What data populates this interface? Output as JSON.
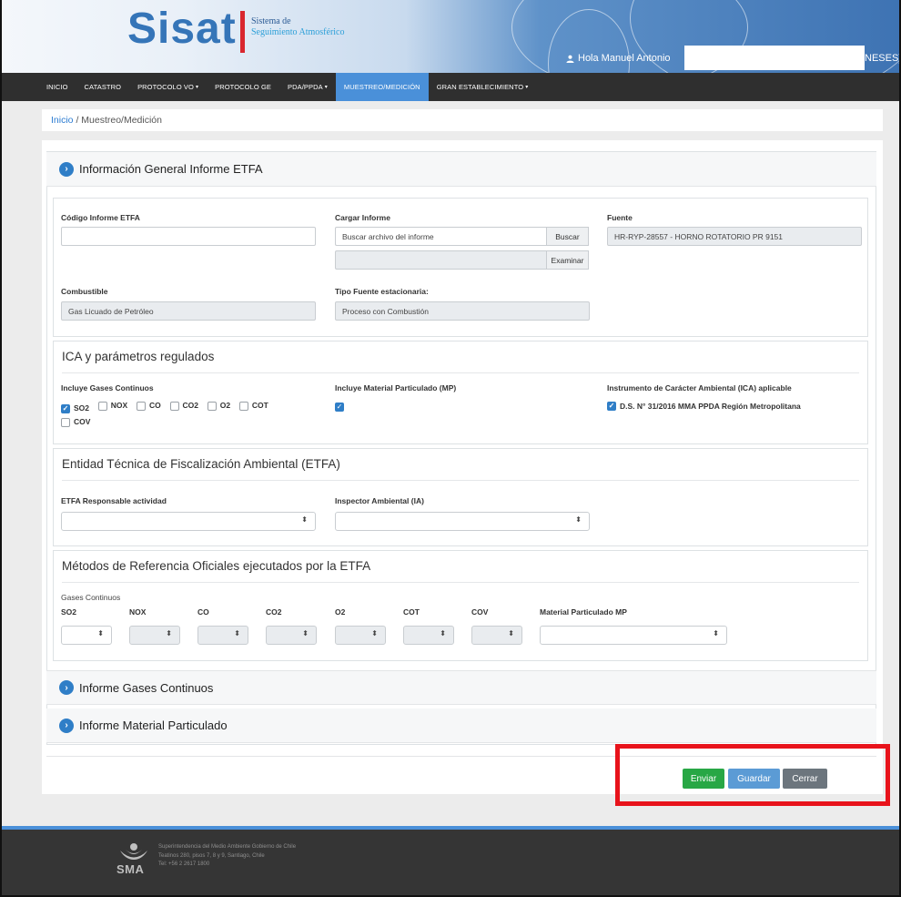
{
  "header": {
    "logo": "Sisat",
    "logo_sub1": "Sistema de",
    "logo_sub2": "Seguimiento Atmosférico",
    "user_greeting": "Hola Manuel Antonio",
    "user_tail": "NESES)",
    "user_icon": "user-icon"
  },
  "nav": {
    "items": [
      {
        "label": "INICIO",
        "dropdown": false
      },
      {
        "label": "CATASTRO",
        "dropdown": false
      },
      {
        "label": "PROTOCOLO VO",
        "dropdown": true
      },
      {
        "label": "PROTOCOLO GE",
        "dropdown": false
      },
      {
        "label": "PDA/PPDA",
        "dropdown": true
      },
      {
        "label": "MUESTREO/MEDICIÓN",
        "dropdown": false,
        "active": true
      },
      {
        "label": "GRAN ESTABLECIMIENTO",
        "dropdown": true
      }
    ],
    "active_color": "#4a90d9"
  },
  "breadcrumb": {
    "home": "Inicio",
    "separator": "/",
    "current": "Muestreo/Medición"
  },
  "sections": {
    "general": {
      "title": "Información General Informe ETFA",
      "codigo_label": "Código Informe ETFA",
      "codigo_value": "",
      "cargar_label": "Cargar Informe",
      "cargar_placeholder": "Buscar archivo del informe",
      "buscar_button": "Buscar",
      "examinar_button": "Examinar",
      "fuente_label": "Fuente",
      "fuente_value": "HR-RYP-28557 - HORNO ROTATORIO PR 9151",
      "combustible_label": "Combustible",
      "combustible_value": "Gas Licuado de Petróleo",
      "tipo_label": "Tipo Fuente estacionaria:",
      "tipo_value": "Proceso con Combustión"
    },
    "ica": {
      "title": "ICA y parámetros regulados",
      "gases_label": "Incluye Gases Continuos",
      "gases": [
        {
          "label": "SO2",
          "checked": true
        },
        {
          "label": "NOX",
          "checked": false
        },
        {
          "label": "CO",
          "checked": false
        },
        {
          "label": "CO2",
          "checked": false
        },
        {
          "label": "O2",
          "checked": false
        },
        {
          "label": "COT",
          "checked": false
        },
        {
          "label": "COV",
          "checked": false
        }
      ],
      "mp_label": "Incluye Material Particulado (MP)",
      "mp_checked": true,
      "instrumento_label": "Instrumento de Carácter Ambiental (ICA) aplicable",
      "instrumento_value": "D.S. N° 31/2016 MMA PPDA Región Metropolitana",
      "instrumento_checked": true
    },
    "etfa": {
      "title": "Entidad Técnica de Fiscalización Ambiental (ETFA)",
      "responsable_label": "ETFA Responsable actividad",
      "responsable_value": "",
      "inspector_label": "Inspector Ambiental (IA)",
      "inspector_value": ""
    },
    "metodos": {
      "title": "Métodos de Referencia Oficiales ejecutados por la ETFA",
      "gases_caption": "Gases Continuos",
      "columns": [
        {
          "label": "SO2",
          "disabled": false
        },
        {
          "label": "NOX",
          "disabled": true
        },
        {
          "label": "CO",
          "disabled": true
        },
        {
          "label": "CO2",
          "disabled": true
        },
        {
          "label": "O2",
          "disabled": true
        },
        {
          "label": "COT",
          "disabled": true
        },
        {
          "label": "COV",
          "disabled": true
        }
      ],
      "mp_label": "Material Particulado MP"
    },
    "gases_report": {
      "title": "Informe Gases Continuos"
    },
    "mp_report": {
      "title": "Informe Material Particulado"
    }
  },
  "actions": {
    "enviar": "Enviar",
    "guardar": "Guardar",
    "cerrar": "Cerrar",
    "colors": {
      "enviar": "#28a745",
      "guardar": "#5b9bd5",
      "cerrar": "#6c757d",
      "highlight": "#e8131b"
    }
  },
  "footer": {
    "logo_text": "SMA",
    "line1": "Superintendencia del Medio Ambiente Gobierno de Chile",
    "line2": "Teatinos 280, pisos 7, 8 y 9, Santiago, Chile",
    "line3": "Tel: +56 2 2617 1800"
  }
}
